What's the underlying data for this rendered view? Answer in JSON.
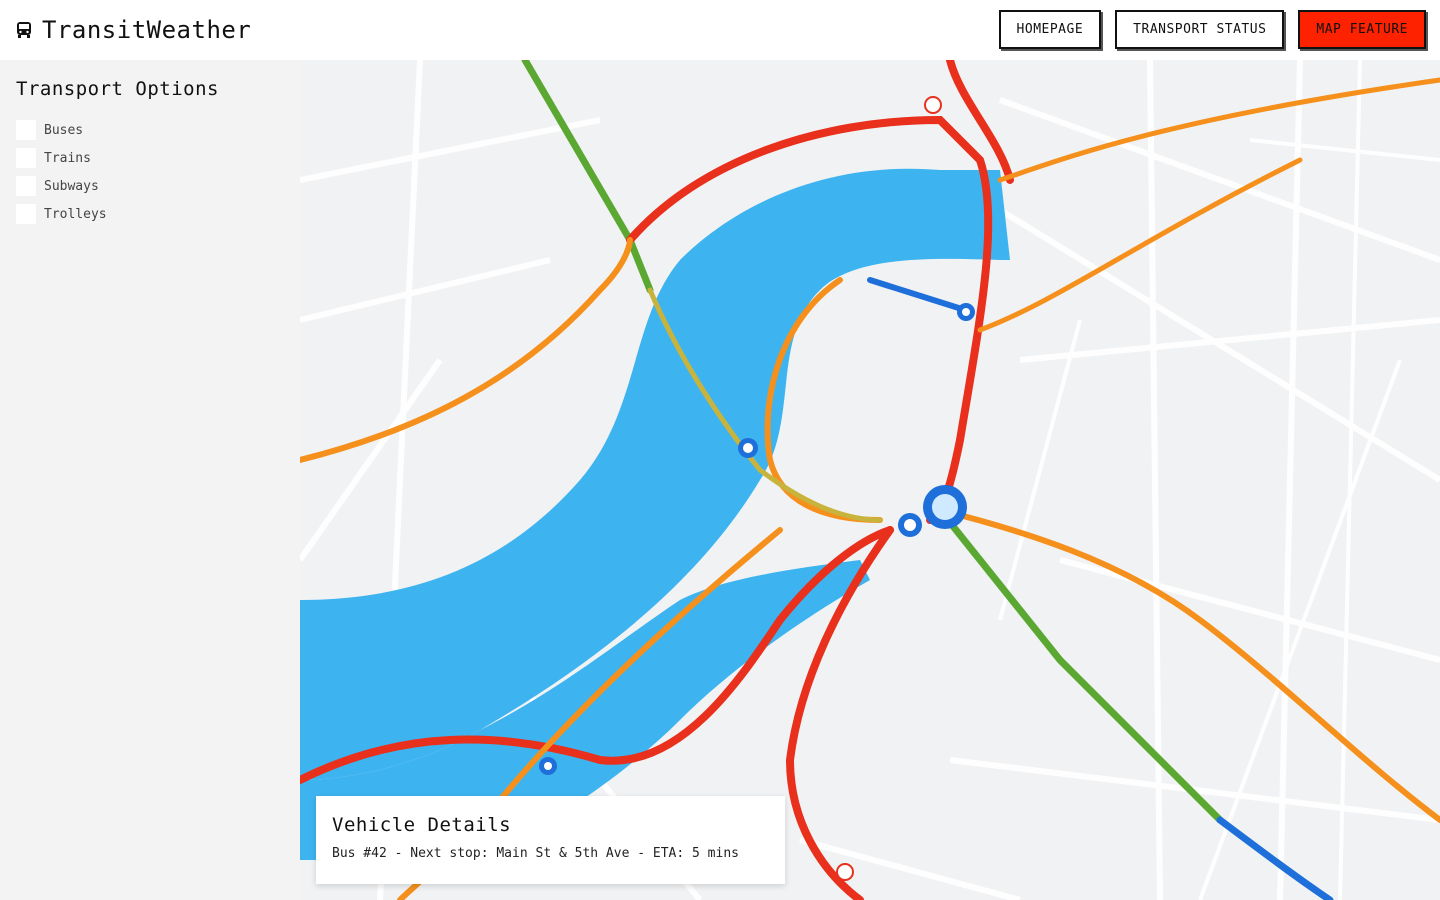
{
  "header": {
    "brand_icon": "bus-icon",
    "brand_title": "TransitWeather",
    "nav": [
      {
        "label": "HOMEPAGE"
      },
      {
        "label": "TRANSPORT STATUS"
      },
      {
        "label": "MAP FEATURE",
        "active": true
      }
    ]
  },
  "sidebar": {
    "title": "Transport Options",
    "options": [
      {
        "label": "Buses",
        "checked": false
      },
      {
        "label": "Trains",
        "checked": false
      },
      {
        "label": "Subways",
        "checked": false
      },
      {
        "label": "Trolleys",
        "checked": false
      }
    ]
  },
  "details": {
    "title": "Vehicle Details",
    "text": "Bus #42 - Next stop: Main St & 5th Ave - ETA: 5 mins"
  },
  "colors": {
    "accent": "#ff2200",
    "river": "#3db4f0",
    "line_red": "#e8301c",
    "line_orange": "#f5901c",
    "line_green": "#5aa832",
    "line_blue": "#1e6fd9"
  }
}
